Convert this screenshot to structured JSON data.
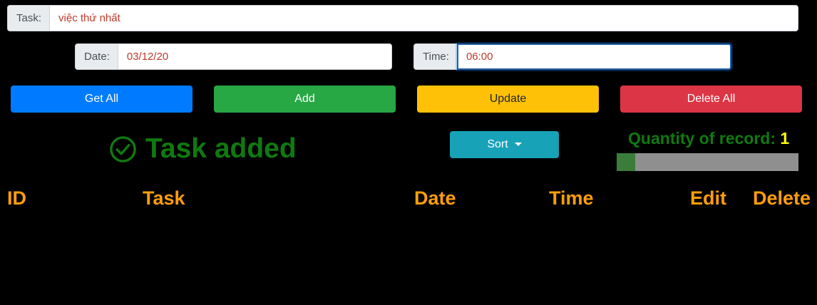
{
  "task": {
    "label": "Task:",
    "value": "việc thứ nhất"
  },
  "date": {
    "label": "Date:",
    "value": "03/12/20"
  },
  "time": {
    "label": "Time:",
    "value": "06:00"
  },
  "buttons": {
    "get_all": "Get All",
    "add": "Add",
    "update": "Update",
    "delete_all": "Delete All"
  },
  "status": {
    "message": "Task added",
    "icon": "check-circle-icon"
  },
  "sort": {
    "label": "Sort"
  },
  "quantity": {
    "label": "Quantity of record:",
    "count": "1",
    "progress_fraction": 0.1
  },
  "table": {
    "headers": [
      "ID",
      "Task",
      "Date",
      "Time",
      "Edit",
      "Delete"
    ]
  },
  "colors": {
    "get_all": "#007bff",
    "add": "#28a745",
    "update": "#ffc107",
    "delete_all": "#dc3545",
    "sort": "#17a2b8",
    "status": "#0f7a0f",
    "header": "#ff9e0a",
    "count": "#ffff00"
  }
}
